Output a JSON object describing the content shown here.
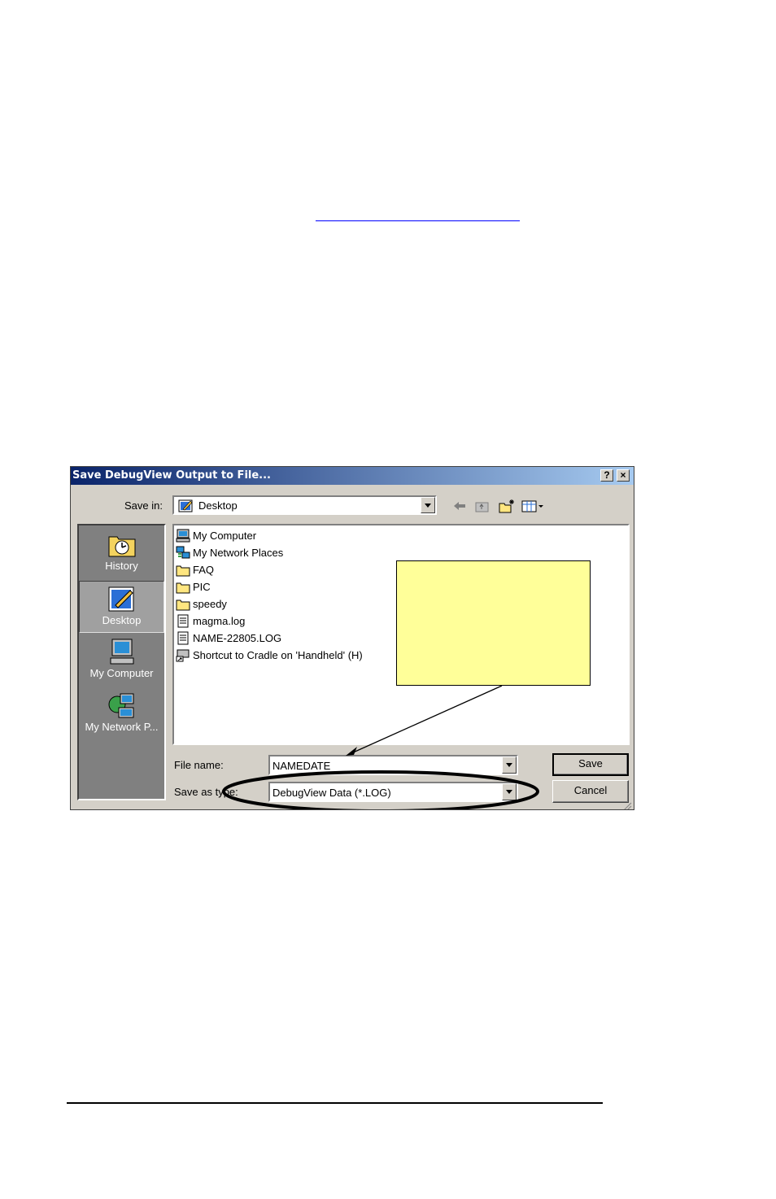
{
  "dialog": {
    "title": "Save DebugView Output to File...",
    "help_label": "?",
    "close_label": "×",
    "save_in": {
      "label": "Save in:",
      "value": "Desktop"
    },
    "toolbar": {
      "back_icon": "back-arrow-icon",
      "up_icon": "up-folder-icon",
      "new_folder_icon": "new-folder-icon",
      "views_icon": "view-menu-icon"
    },
    "places": [
      {
        "label": "History",
        "icon": "history-icon"
      },
      {
        "label": "Desktop",
        "icon": "desktop-icon",
        "selected": true
      },
      {
        "label": "My Computer",
        "icon": "my-computer-icon"
      },
      {
        "label": "My Network P...",
        "icon": "network-places-icon"
      }
    ],
    "files": [
      {
        "name": "My Computer",
        "icon": "computer-icon"
      },
      {
        "name": "My Network Places",
        "icon": "network-icon"
      },
      {
        "name": "FAQ",
        "icon": "folder-icon"
      },
      {
        "name": "PIC",
        "icon": "folder-icon"
      },
      {
        "name": "speedy",
        "icon": "folder-icon"
      },
      {
        "name": "magma.log",
        "icon": "text-file-icon"
      },
      {
        "name": "NAME-22805.LOG",
        "icon": "text-file-icon"
      },
      {
        "name": "Shortcut to Cradle on 'Handheld' (H)",
        "icon": "shortcut-icon"
      }
    ],
    "file_name": {
      "label": "File name:",
      "value": "NAMEDATE"
    },
    "file_type": {
      "label": "Save as type:",
      "value": "DebugView Data (*.LOG)"
    },
    "buttons": {
      "save": "Save",
      "cancel": "Cancel"
    }
  },
  "colors": {
    "title_start": "#0a246a",
    "title_end": "#a6caf0",
    "dialog_face": "#d4d0c8",
    "callout_fill": "#ffff99",
    "link_underline": "#0000ff"
  }
}
